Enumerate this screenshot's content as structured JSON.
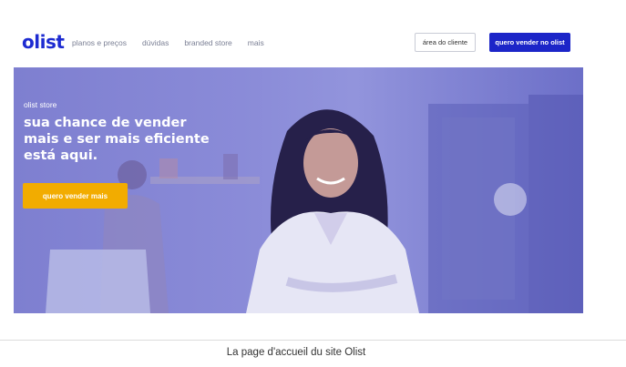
{
  "header": {
    "logo": "olist",
    "nav": [
      "planos e preços",
      "dúvidas",
      "branded store",
      "mais"
    ],
    "client_area": "área do cliente",
    "sell_button": "quero vender no olist"
  },
  "hero": {
    "label": "olist store",
    "title": "sua chance de vender mais e ser mais eficiente está aqui.",
    "cta": "quero vender mais"
  },
  "caption": "La page d'accueil du site Olist",
  "colors": {
    "brand_blue": "#1c25c8",
    "cta_yellow": "#f2ac00",
    "hero_overlay": "#8a8bd8"
  }
}
